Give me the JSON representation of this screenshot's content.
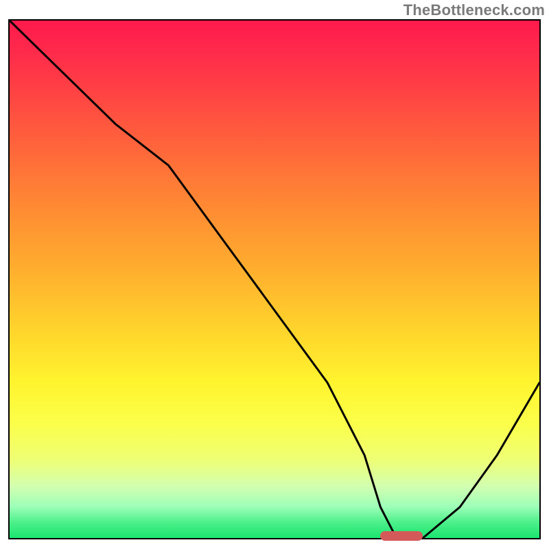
{
  "watermark": "TheBottleneck.com",
  "chart_data": {
    "type": "line",
    "title": "",
    "xlabel": "",
    "ylabel": "",
    "xlim": [
      0,
      100
    ],
    "ylim": [
      0,
      100
    ],
    "grid": false,
    "series": [
      {
        "name": "curve",
        "x": [
          0,
          10,
          20,
          30,
          40,
          50,
          60,
          67,
          70,
          73,
          78,
          85,
          92,
          100
        ],
        "y": [
          100,
          90,
          80,
          72,
          58,
          44,
          30,
          16,
          6,
          0,
          0,
          6,
          16,
          30
        ]
      }
    ],
    "highlight_marker": {
      "x_start": 70,
      "x_end": 78,
      "y": 0,
      "color": "#d45a5a"
    },
    "gradient_stops": [
      {
        "pos": 0,
        "color": "#ff1a4b"
      },
      {
        "pos": 50,
        "color": "#ffae2e"
      },
      {
        "pos": 78,
        "color": "#fbff4a"
      },
      {
        "pos": 100,
        "color": "#1be570"
      }
    ],
    "legend": false
  }
}
